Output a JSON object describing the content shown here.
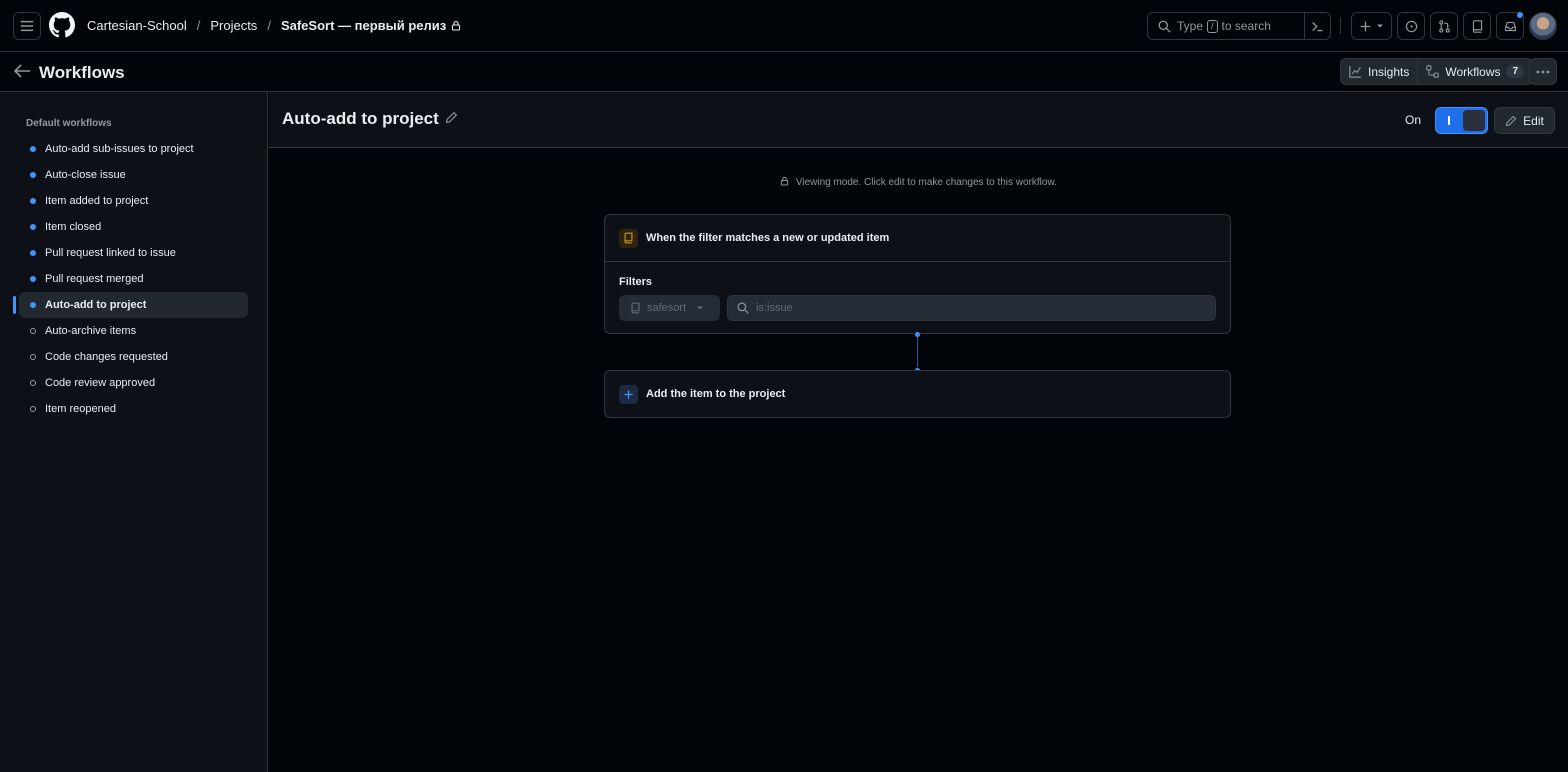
{
  "topbar": {
    "breadcrumb": [
      "Cartesian-School",
      "Projects",
      "SafeSort — первый релиз"
    ],
    "search_prefix": "Type",
    "search_key": "/",
    "search_suffix": "to search"
  },
  "subheader": {
    "title": "Workflows",
    "insights_label": "Insights",
    "workflows_label": "Workflows",
    "workflows_count": "7"
  },
  "sidebar": {
    "section_title": "Default workflows",
    "items": [
      {
        "label": "Auto-add sub-issues to project",
        "enabled": true
      },
      {
        "label": "Auto-close issue",
        "enabled": true
      },
      {
        "label": "Item added to project",
        "enabled": true
      },
      {
        "label": "Item closed",
        "enabled": true
      },
      {
        "label": "Pull request linked to issue",
        "enabled": true
      },
      {
        "label": "Pull request merged",
        "enabled": true
      },
      {
        "label": "Auto-add to project",
        "enabled": true,
        "active": true
      },
      {
        "label": "Auto-archive items",
        "enabled": false
      },
      {
        "label": "Code changes requested",
        "enabled": false
      },
      {
        "label": "Code review approved",
        "enabled": false
      },
      {
        "label": "Item reopened",
        "enabled": false
      }
    ]
  },
  "main": {
    "title": "Auto-add to project",
    "on_label": "On",
    "edit_label": "Edit",
    "viewing_notice": "Viewing mode. Click edit to make changes to this workflow.",
    "trigger_card": {
      "title": "When the filter matches a new or updated item",
      "filters_label": "Filters",
      "repo_value": "safesort",
      "filter_placeholder": "is:issue"
    },
    "action_card": {
      "title": "Add the item to the project"
    }
  },
  "colors": {
    "accent": "#4493f8",
    "trigger_icon": "#d29922",
    "background": "#010409",
    "panel": "#0d1117"
  }
}
